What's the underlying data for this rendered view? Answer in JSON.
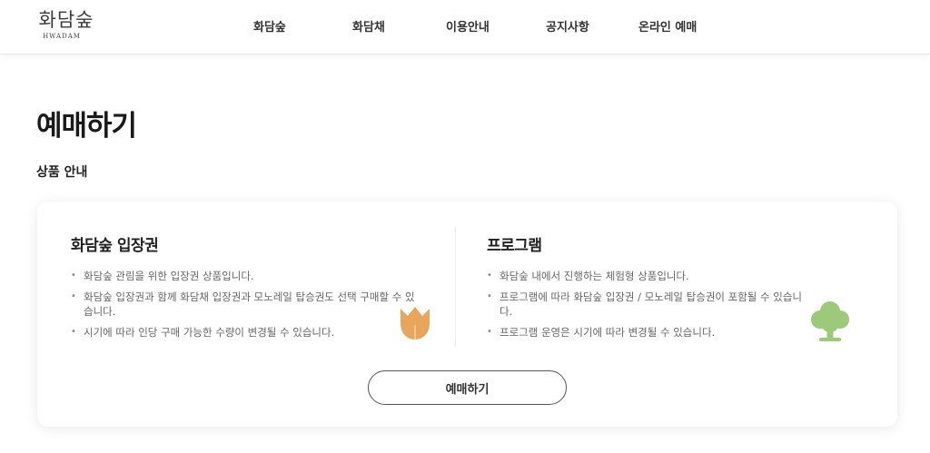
{
  "header": {
    "logo": {
      "main": "화담숲",
      "sub": "HWADAM"
    },
    "nav": [
      "화담숲",
      "화담채",
      "이용안내",
      "공지사항",
      "온라인 예매"
    ]
  },
  "page_title": "예매하기",
  "section_label": "상품 안내",
  "products": [
    {
      "title": "화담숲 입장권",
      "items": [
        "화담숲 관림을 위한 입장권 상품입니다.",
        "화담숲 입장권과 함께 화담채 입장권과 모노레일 탑승권도 선택 구매할 수 있습니다.",
        "시기에 따라 인당 구매 가능한 수량이 변경될 수 있습니다."
      ],
      "icon": "tulip-icon",
      "icon_color": "#e8a55c"
    },
    {
      "title": "프로그램",
      "items": [
        "화담숲 내에서 진행하는 체험형 상품입니다.",
        "프로그램에 따라 화담숲 입장권 / 모노레일 탑승권이 포함될 수 있습니다.",
        "프로그램 운영은 시기에 따라 변경될 수 있습니다."
      ],
      "icon": "tree-icon",
      "icon_color": "#9cc97a"
    }
  ],
  "button_label": "예매하기"
}
